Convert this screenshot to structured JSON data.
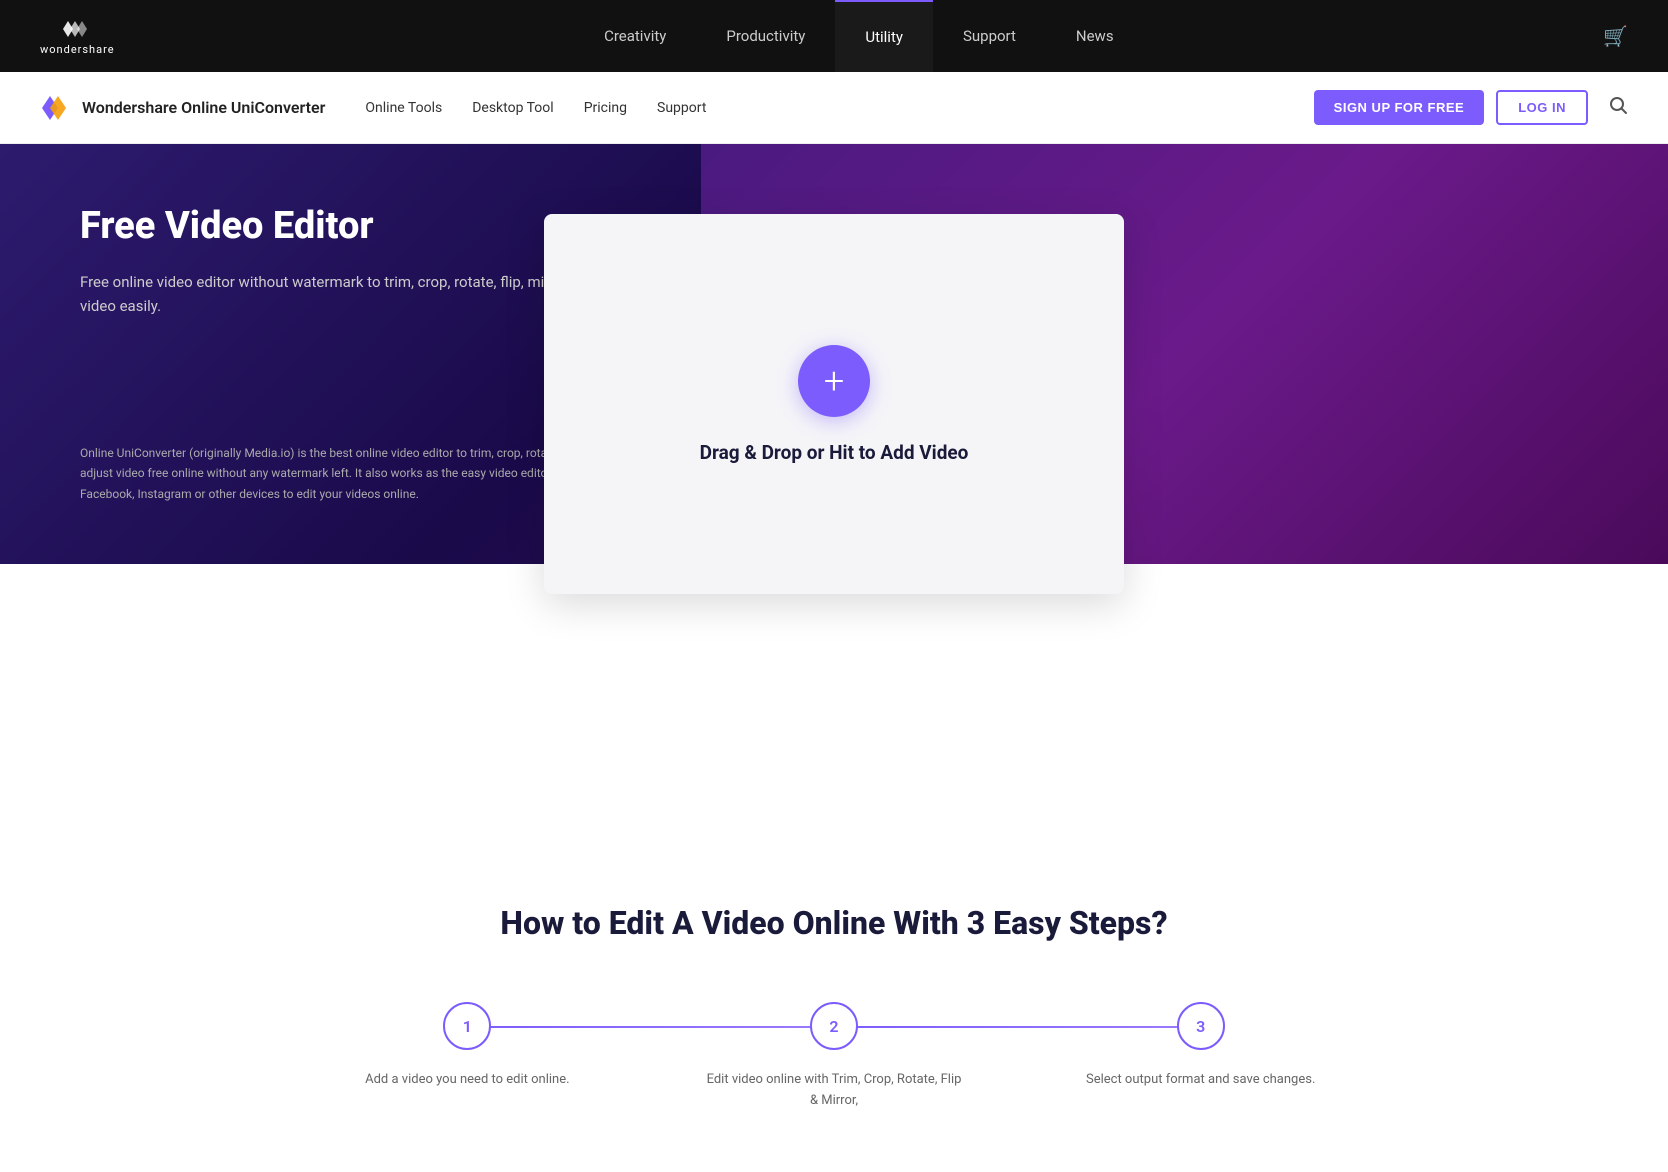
{
  "top_nav": {
    "logo_text": "wondershare",
    "links": [
      {
        "label": "Creativity",
        "active": false
      },
      {
        "label": "Productivity",
        "active": false
      },
      {
        "label": "Utility",
        "active": true
      },
      {
        "label": "Support",
        "active": false
      },
      {
        "label": "News",
        "active": false
      }
    ]
  },
  "sub_nav": {
    "brand_name": "Wondershare Online UniConverter",
    "links": [
      {
        "label": "Online Tools"
      },
      {
        "label": "Desktop Tool"
      },
      {
        "label": "Pricing"
      },
      {
        "label": "Support"
      }
    ],
    "btn_signup": "SIGN UP FOR FREE",
    "btn_login": "LOG IN"
  },
  "hero": {
    "title": "Free Video Editor",
    "subtitle": "Free online video editor without watermark to trim, crop, rotate, flip, mirror, and adjust video easily.",
    "description": "Online UniConverter (originally Media.io) is the best online video editor to trim, crop, rotate, flip, mirror and adjust video free online without any watermark left. It also works as the easy video editor for YouTube, Facebook, Instagram or other devices to edit your videos online.",
    "upload_text": "Drag & Drop or Hit to Add Video"
  },
  "steps": {
    "title": "How to Edit A Video Online With 3 Easy Steps?",
    "items": [
      {
        "number": "1",
        "desc": "Add a video you need to edit online."
      },
      {
        "number": "2",
        "desc": "Edit video online with Trim, Crop, Rotate, Flip & Mirror,"
      },
      {
        "number": "3",
        "desc": "Select output format and save changes."
      }
    ]
  }
}
